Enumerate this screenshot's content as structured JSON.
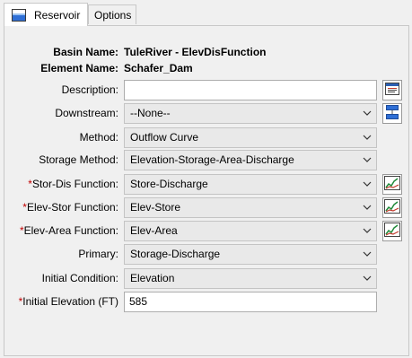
{
  "tabs": [
    {
      "label": "Reservoir",
      "icon": "reservoir-icon",
      "active": true
    },
    {
      "label": "Options",
      "active": false
    }
  ],
  "basin": {
    "label": "Basin Name:",
    "value": "TuleRiver - ElevDisFunction"
  },
  "element": {
    "label": "Element Name:",
    "value": "Schafer_Dam"
  },
  "description": {
    "label": "Description:",
    "value": ""
  },
  "downstream": {
    "label": "Downstream:",
    "value": "--None--"
  },
  "method": {
    "label": "Method:",
    "value": "Outflow Curve"
  },
  "storage_method": {
    "label": "Storage Method:",
    "value": "Elevation-Storage-Area-Discharge"
  },
  "stor_dis": {
    "required": "*",
    "label": "Stor-Dis Function:",
    "value": "Store-Discharge"
  },
  "elev_stor": {
    "required": "*",
    "label": "Elev-Stor Function:",
    "value": "Elev-Store"
  },
  "elev_area": {
    "required": "*",
    "label": "Elev-Area Function:",
    "value": "Elev-Area"
  },
  "primary": {
    "label": "Primary:",
    "value": "Storage-Discharge"
  },
  "initial_condition": {
    "label": "Initial Condition:",
    "value": "Elevation"
  },
  "initial_elevation": {
    "required": "*",
    "label": "Initial Elevation (FT)",
    "value": "585"
  },
  "colors": {
    "required": "#c00000",
    "field_border": "#adadad",
    "combo_bg": "#e9e9e9"
  }
}
